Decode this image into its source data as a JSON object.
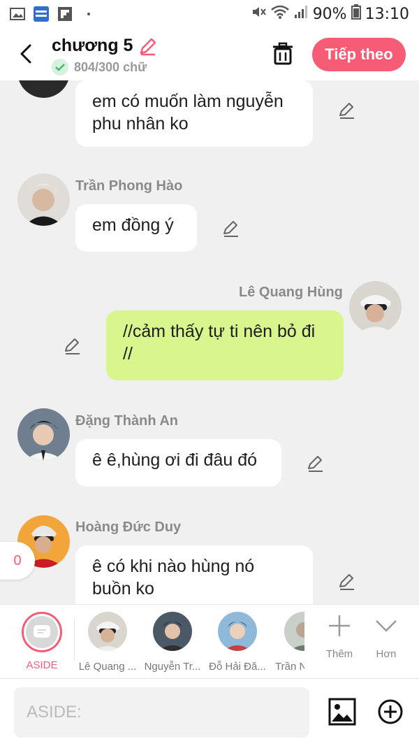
{
  "status_bar": {
    "battery": "90%",
    "time": "13:10"
  },
  "header": {
    "title": "chương 5",
    "word_count": "804/300 chữ",
    "next_label": "Tiếp theo"
  },
  "messages": [
    {
      "name": "",
      "text": "em có muốn làm nguyễn phu nhân ko",
      "side": "left"
    },
    {
      "name": "Trần Phong Hào",
      "text": "em đồng ý",
      "side": "left"
    },
    {
      "name": "Lê Quang Hùng",
      "text": "//cảm thấy tự ti nên bỏ đi //",
      "side": "right"
    },
    {
      "name": "Đặng Thành An",
      "text": "ê ê,hùng ơi đi đâu đó",
      "side": "left"
    },
    {
      "name": "Hoàng Đức Duy",
      "text": "ê có khi nào hùng nó buồn ko",
      "side": "left"
    }
  ],
  "badge_count": "0",
  "characters": [
    {
      "label": "ASIDE"
    },
    {
      "label": "Lê Quang ..."
    },
    {
      "label": "Nguyễn Tr..."
    },
    {
      "label": "Đỗ Hải Đă..."
    },
    {
      "label": "Trần N"
    }
  ],
  "tools": {
    "add_label": "Thêm",
    "more_label": "Hơn"
  },
  "input": {
    "placeholder": "ASIDE:"
  },
  "colors": {
    "accent": "#f75c77",
    "right_bubble": "#d8f58e",
    "background": "#f0f0f0"
  }
}
